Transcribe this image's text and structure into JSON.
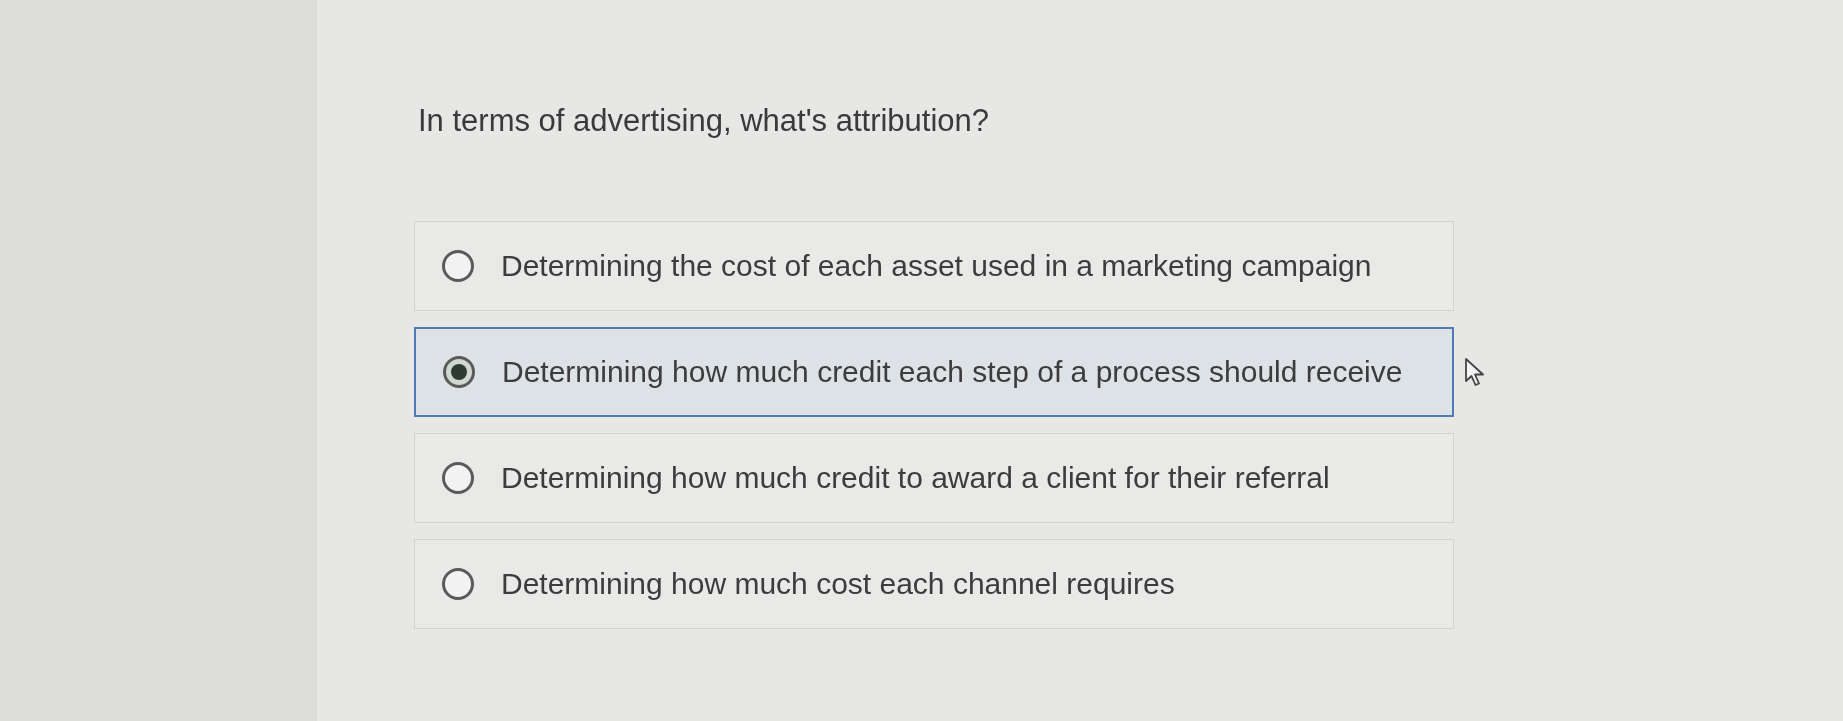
{
  "question": {
    "text": "In terms of advertising, what's attribution?"
  },
  "options": [
    {
      "label": "Determining the cost of each asset used in a marketing campaign",
      "selected": false
    },
    {
      "label": "Determining how much credit each step of a process should receive",
      "selected": true
    },
    {
      "label": "Determining how much credit to award a client for their referral",
      "selected": false
    },
    {
      "label": "Determining how much cost each channel requires",
      "selected": false
    }
  ]
}
